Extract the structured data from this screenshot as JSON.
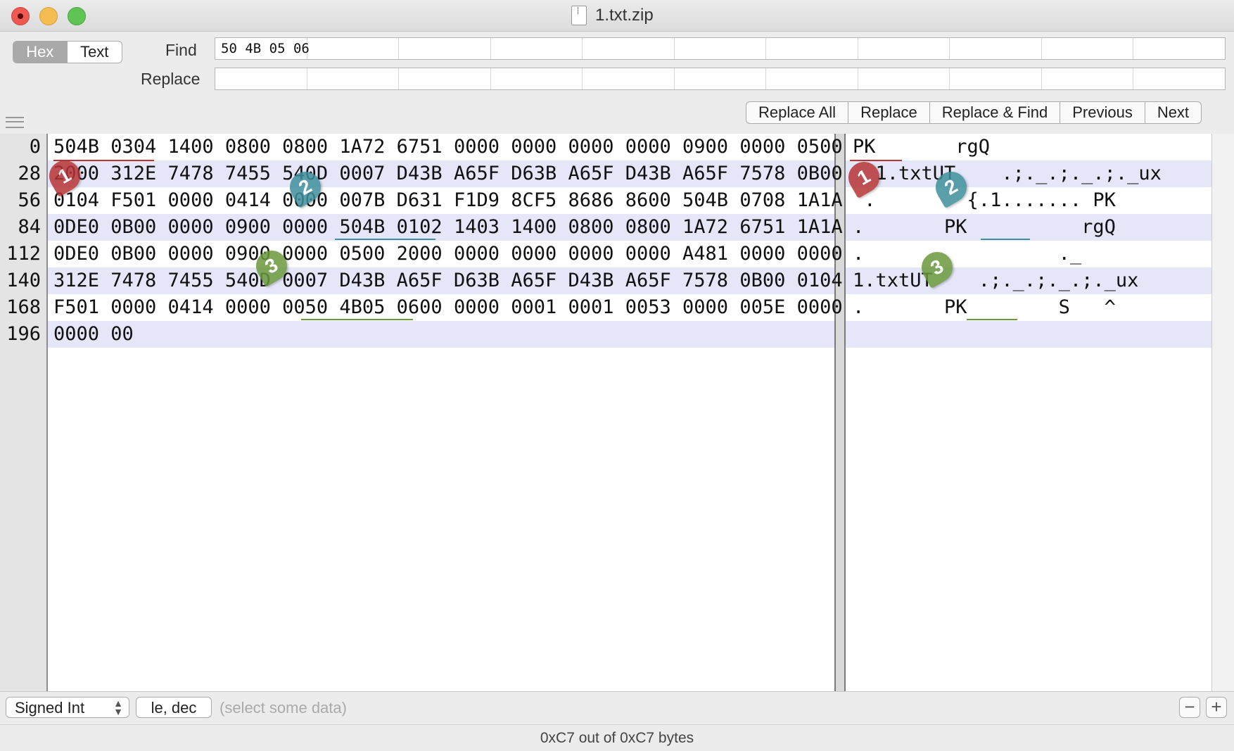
{
  "window": {
    "title": "1.txt.zip"
  },
  "toolbar": {
    "mode_hex": "Hex",
    "mode_text": "Text",
    "find_label": "Find",
    "replace_label": "Replace",
    "find_value": "50 4B 05 06",
    "replace_value": "",
    "buttons": [
      "Replace All",
      "Replace",
      "Replace & Find",
      "Previous",
      "Next"
    ]
  },
  "offsets": [
    "0",
    "28",
    "56",
    "84",
    "112",
    "140",
    "168",
    "196"
  ],
  "hex_rows": [
    "504B 0304 1400 0800 0800 1A72 6751 0000 0000 0000 0000 0900 0000 0500",
    "2000 312E 7478 7455 540D 0007 D43B A65F D63B A65F D43B A65F 7578 0B00",
    "0104 F501 0000 0414 0000 007B D631 F1D9 8CF5 8686 8600 504B 0708 1A1A",
    "0DE0 0B00 0000 0900 0000 504B 0102 1403 1400 0800 0800 1A72 6751 1A1A",
    "0DE0 0B00 0000 0900 0000 0500 2000 0000 0000 0000 0000 A481 0000 0000",
    "312E 7478 7455 540D 0007 D43B A65F D63B A65F D43B A65F 7578 0B00 0104",
    "F501 0000 0414 0000 0050 4B05 0600 0000 0001 0001 0053 0000 005E 0000",
    "0000 00"
  ],
  "text_rows": [
    "PK       rgQ",
    "  1.txtUT    .;._.;._.;._ux",
    " .        {.1....... PK",
    ".       PK          rgQ",
    ".                 ._",
    "1.txtUT    .;._.;._.;._ux",
    ".       PK        S   ^",
    ""
  ],
  "annotations": [
    {
      "label": "1",
      "color": "#b73434"
    },
    {
      "label": "2",
      "color": "#3f8f9c"
    },
    {
      "label": "3",
      "color": "#6a9a3c"
    }
  ],
  "bottom": {
    "type_select": "Signed Int",
    "endian": "le, dec",
    "hint": "(select some data)",
    "minus": "−",
    "plus": "+"
  },
  "status": "0xC7 out of 0xC7 bytes"
}
